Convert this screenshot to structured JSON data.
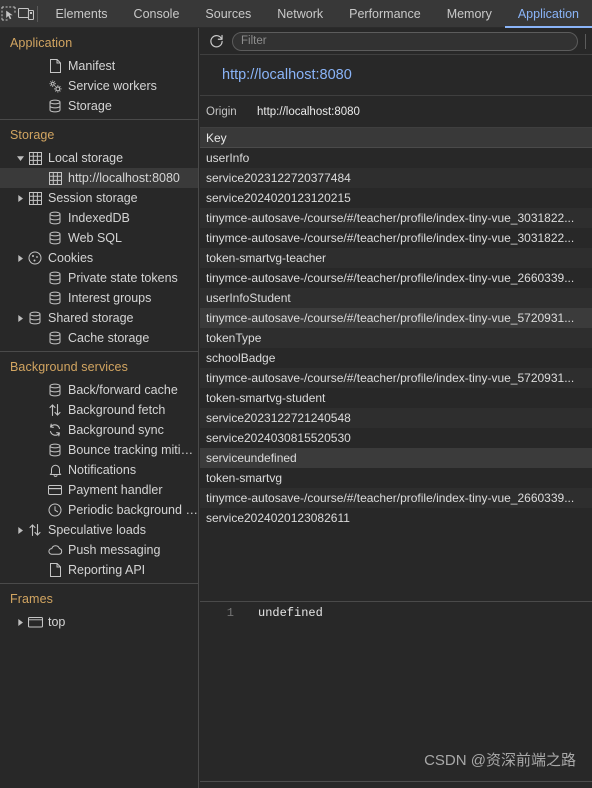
{
  "toolbar": {
    "icons": [
      {
        "name": "inspect-element-icon"
      },
      {
        "name": "device-toolbar-icon"
      }
    ],
    "tabs": [
      {
        "label": "Elements",
        "active": false
      },
      {
        "label": "Console",
        "active": false
      },
      {
        "label": "Sources",
        "active": false
      },
      {
        "label": "Network",
        "active": false
      },
      {
        "label": "Performance",
        "active": false
      },
      {
        "label": "Memory",
        "active": false
      },
      {
        "label": "Application",
        "active": true
      }
    ]
  },
  "sidebar": {
    "sections": [
      {
        "title": "Application",
        "items": [
          {
            "label": "Manifest",
            "icon": "manifest-file-icon",
            "indent": 2,
            "twisty": "none",
            "selected": false
          },
          {
            "label": "Service workers",
            "icon": "service-workers-gear-icon",
            "indent": 2,
            "twisty": "none",
            "selected": false
          },
          {
            "label": "Storage",
            "icon": "database-icon",
            "indent": 2,
            "twisty": "none",
            "selected": false
          }
        ]
      },
      {
        "title": "Storage",
        "items": [
          {
            "label": "Local storage",
            "icon": "table-grid-icon",
            "indent": 1,
            "twisty": "expanded",
            "selected": false
          },
          {
            "label": "http://localhost:8080",
            "icon": "table-grid-icon",
            "indent": 2,
            "twisty": "none",
            "selected": true
          },
          {
            "label": "Session storage",
            "icon": "table-grid-icon",
            "indent": 1,
            "twisty": "collapsed",
            "selected": false
          },
          {
            "label": "IndexedDB",
            "icon": "database-icon",
            "indent": 2,
            "twisty": "none",
            "selected": false
          },
          {
            "label": "Web SQL",
            "icon": "database-icon",
            "indent": 2,
            "twisty": "none",
            "selected": false
          },
          {
            "label": "Cookies",
            "icon": "cookie-icon",
            "indent": 1,
            "twisty": "collapsed",
            "selected": false
          },
          {
            "label": "Private state tokens",
            "icon": "database-icon",
            "indent": 2,
            "twisty": "none",
            "selected": false
          },
          {
            "label": "Interest groups",
            "icon": "database-icon",
            "indent": 2,
            "twisty": "none",
            "selected": false
          },
          {
            "label": "Shared storage",
            "icon": "database-icon",
            "indent": 1,
            "twisty": "collapsed",
            "selected": false
          },
          {
            "label": "Cache storage",
            "icon": "database-icon",
            "indent": 2,
            "twisty": "none",
            "selected": false
          }
        ]
      },
      {
        "title": "Background services",
        "items": [
          {
            "label": "Back/forward cache",
            "icon": "database-icon",
            "indent": 2,
            "twisty": "none",
            "selected": false
          },
          {
            "label": "Background fetch",
            "icon": "arrows-up-down-icon",
            "indent": 2,
            "twisty": "none",
            "selected": false
          },
          {
            "label": "Background sync",
            "icon": "sync-arrows-icon",
            "indent": 2,
            "twisty": "none",
            "selected": false
          },
          {
            "label": "Bounce tracking mitigations",
            "icon": "database-icon",
            "indent": 2,
            "twisty": "none",
            "selected": false
          },
          {
            "label": "Notifications",
            "icon": "bell-icon",
            "indent": 2,
            "twisty": "none",
            "selected": false
          },
          {
            "label": "Payment handler",
            "icon": "credit-card-icon",
            "indent": 2,
            "twisty": "none",
            "selected": false
          },
          {
            "label": "Periodic background sync",
            "icon": "clock-icon",
            "indent": 2,
            "twisty": "none",
            "selected": false
          },
          {
            "label": "Speculative loads",
            "icon": "arrows-up-down-icon",
            "indent": 1,
            "twisty": "collapsed",
            "selected": false
          },
          {
            "label": "Push messaging",
            "icon": "cloud-icon",
            "indent": 2,
            "twisty": "none",
            "selected": false
          },
          {
            "label": "Reporting API",
            "icon": "manifest-file-icon",
            "indent": 2,
            "twisty": "none",
            "selected": false
          }
        ]
      },
      {
        "title": "Frames",
        "items": [
          {
            "label": "top",
            "icon": "frame-window-icon",
            "indent": 1,
            "twisty": "collapsed",
            "selected": false
          }
        ]
      }
    ]
  },
  "main": {
    "refresh_icon": "refresh-icon",
    "filter_placeholder": "Filter",
    "filter_value": "",
    "origin_title": "http://localhost:8080",
    "origin_label": "Origin",
    "origin_value": "http://localhost:8080",
    "grid": {
      "columns": [
        "Key"
      ],
      "rows": [
        {
          "key": "userInfo",
          "highlight": false
        },
        {
          "key": "service2023122720377484",
          "highlight": false
        },
        {
          "key": "service2024020123120215",
          "highlight": false
        },
        {
          "key": "tinymce-autosave-/course/#/teacher/profile/index-tiny-vue_3031822...",
          "highlight": false
        },
        {
          "key": "tinymce-autosave-/course/#/teacher/profile/index-tiny-vue_3031822...",
          "highlight": false
        },
        {
          "key": "token-smartvg-teacher",
          "highlight": false
        },
        {
          "key": "tinymce-autosave-/course/#/teacher/profile/index-tiny-vue_2660339...",
          "highlight": false
        },
        {
          "key": "userInfoStudent",
          "highlight": false
        },
        {
          "key": "tinymce-autosave-/course/#/teacher/profile/index-tiny-vue_5720931...",
          "highlight": true
        },
        {
          "key": "tokenType",
          "highlight": false
        },
        {
          "key": "schoolBadge",
          "highlight": false
        },
        {
          "key": "tinymce-autosave-/course/#/teacher/profile/index-tiny-vue_5720931...",
          "highlight": false
        },
        {
          "key": "token-smartvg-student",
          "highlight": false
        },
        {
          "key": "service2023122721240548",
          "highlight": false
        },
        {
          "key": "service2024030815520530",
          "highlight": false
        },
        {
          "key": "serviceundefined",
          "highlight": true
        },
        {
          "key": "token-smartvg",
          "highlight": false
        },
        {
          "key": "tinymce-autosave-/course/#/teacher/profile/index-tiny-vue_2660339...",
          "highlight": false
        },
        {
          "key": "service2024020123082611",
          "highlight": false
        }
      ]
    },
    "preview": {
      "line_number": "1",
      "value": "undefined"
    }
  },
  "watermark": "CSDN @资深前端之路",
  "colors": {
    "accent": "#8ab4f8",
    "section_title": "#d2a561",
    "background": "#282828",
    "toolbar_background": "#383838",
    "row_highlight": "#3b3b3b"
  }
}
